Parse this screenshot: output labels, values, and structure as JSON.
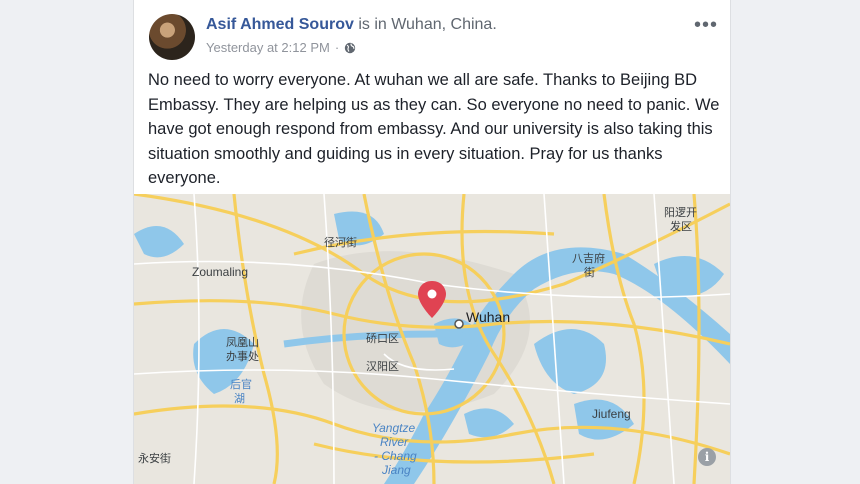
{
  "post": {
    "author": "Asif Ahmed Sourov",
    "location_prefix": " is in ",
    "location": "Wuhan, China.",
    "timestamp": "Yesterday at 2:12 PM",
    "separator": "·",
    "privacy_icon": "globe-icon",
    "more_label": "•••",
    "body": "No need to worry everyone. At wuhan we all are safe. Thanks to Beijing BD Embassy. They are helping us as they can. So everyone no need to panic. We have got enough respond from embassy. And our university is also taking this situation smoothly and guiding us in every situation. Pray for us thanks everyone."
  },
  "map": {
    "labels": {
      "wuhan": "Wuhan",
      "zoumaling": "Zoumaling",
      "qiaokou": "硚口区",
      "hanyang": "汉阳区",
      "yangtze1": "Yangtze",
      "yangtze2": "River",
      "yangtze3": "- Chang",
      "yangtze4": "Jiang",
      "jiufeng": "Jiufeng",
      "fenghuang1": "凤凰山",
      "fenghuang2": "办事处",
      "jinghe": "径河街",
      "yangluo1": "阳逻开",
      "yangluo2": "发区",
      "bajixiang1": "八吉府",
      "bajixiang2": "街",
      "yongan": "永安街",
      "hou1": "后官",
      "hou2": "湖"
    },
    "info_label": "i",
    "colors": {
      "land": "#e9e6df",
      "water": "#8fc7ea",
      "road": "#f6cf5c",
      "minor": "#ffffff",
      "pin": "#e04352"
    }
  }
}
